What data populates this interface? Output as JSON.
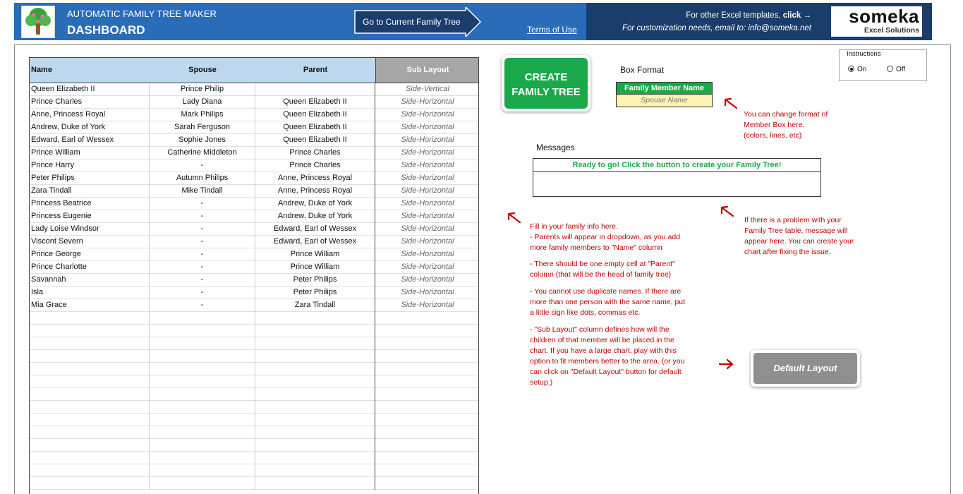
{
  "header": {
    "app_title": "AUTOMATIC FAMILY TREE MAKER",
    "dashboard_title": "DASHBOARD",
    "goto_button": "Go to Current Family Tree",
    "terms_link": "Terms of Use",
    "other_templates_text": "For other Excel templates, ",
    "other_templates_link": "click →",
    "customization_text": "For customization needs, email to: info@someka.net",
    "brand_name": "someka",
    "brand_sub": "Excel Solutions",
    "colors": {
      "header_blue": "#2a6cb8",
      "header_dark": "#1a3d6b"
    }
  },
  "table": {
    "columns": [
      "Name",
      "Spouse",
      "Parent",
      "Sub Layout"
    ],
    "rows": [
      [
        "Queen Elizabeth II",
        "Prince Philip",
        "",
        "Side-Vertical"
      ],
      [
        "Prince Charles",
        "Lady Diana",
        "Queen Elizabeth II",
        "Side-Horizontal"
      ],
      [
        "Anne, Princess Royal",
        "Mark Philips",
        "Queen Elizabeth II",
        "Side-Horizontal"
      ],
      [
        "Andrew, Duke of York",
        "Sarah Ferguson",
        "Queen Elizabeth II",
        "Side-Horizontal"
      ],
      [
        "Edward, Earl of Wessex",
        "Sophie Jones",
        "Queen Elizabeth II",
        "Side-Horizontal"
      ],
      [
        "Prince William",
        "Catherine Middleton",
        "Prince Charles",
        "Side-Horizontal"
      ],
      [
        "Prince Harry",
        "-",
        "Prince Charles",
        "Side-Horizontal"
      ],
      [
        "Peter Philips",
        "Autumn Philips",
        "Anne, Princess Royal",
        "Side-Horizontal"
      ],
      [
        "Zara Tindall",
        "Mike Tindall",
        "Anne, Princess Royal",
        "Side-Horizontal"
      ],
      [
        "Princess Beatrice",
        "-",
        "Andrew, Duke of York",
        "Side-Horizontal"
      ],
      [
        "Princess Eugenie",
        "-",
        "Andrew, Duke of York",
        "Side-Horizontal"
      ],
      [
        "Lady Loise Windsor",
        "-",
        "Edward, Earl of Wessex",
        "Side-Horizontal"
      ],
      [
        "Viscont Severn",
        "-",
        "Edward, Earl of Wessex",
        "Side-Horizontal"
      ],
      [
        "Prince George",
        "-",
        "Prince William",
        "Side-Horizontal"
      ],
      [
        "Prince Charlotte",
        "-",
        "Prince William",
        "Side-Horizontal"
      ],
      [
        "Savannah",
        "-",
        "Peter Philips",
        "Side-Horizontal"
      ],
      [
        "Isla",
        "-",
        "Peter Philips",
        "Side-Horizontal"
      ],
      [
        "Mia Grace",
        "-",
        "Zara Tindall",
        "Side-Horizontal"
      ]
    ]
  },
  "create_button": {
    "line1": "CREATE",
    "line2": "FAMILY TREE",
    "color": "#19a84a"
  },
  "box_format": {
    "label": "Box Format",
    "member_name": "Family Member Name",
    "spouse_name": "Spouse Name",
    "note": "You can change format of\nMember Box here.\n(colors, lines, etc)"
  },
  "messages": {
    "label": "Messages",
    "status": "Ready to go! Click the button to create your Family Tree!",
    "note": "If there is a problem with your\nFamily Tree table, message will\nappear here. You can create your\nchart after fixing the issue."
  },
  "fill_notes": {
    "p1": "Fill in your family info here.\n- Parents will appear in dropdown, as you add\nmore family members to \"Name\" column",
    "p2": "- There should be one empty cell at \"Parent\"\ncolumn (that will be the head of family tree)",
    "p3": "- You cannot use duplicate names. If there are\nmore than one person with the same name, put\na little sign like dots, commas etc.",
    "p4": "- \"Sub Layout\" column defines how will the\nchildren of that member will be placed in the\nchart. If you have a large chart, play with this\noption to fit members better to the area. (or you\ncan click on \"Default Layout\" button for default\nsetup.)"
  },
  "default_button": {
    "label": "Default Layout"
  },
  "instructions": {
    "title": "Instructions",
    "on_label": "On",
    "off_label": "Off",
    "selected": "On"
  }
}
